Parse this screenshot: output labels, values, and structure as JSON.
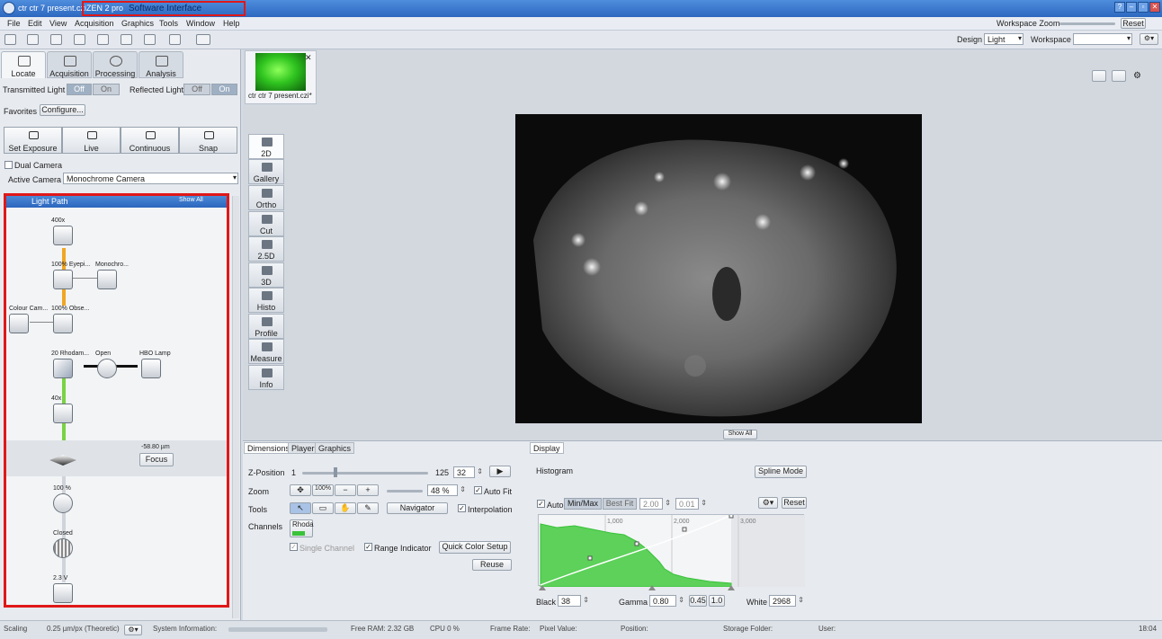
{
  "title_bar": {
    "document": "ctr ctr 7 present.czi",
    "app_name": "ZEN 2 pro",
    "annotation": "Software Interface",
    "buttons": [
      "?",
      "–",
      "▫",
      "✕"
    ]
  },
  "menu": [
    "File",
    "Edit",
    "View",
    "Acquisition",
    "Graphics",
    "Tools",
    "Window",
    "Help"
  ],
  "top_right": {
    "workspace_zoom_label": "Workspace Zoom",
    "reset_label": "Reset",
    "design_label": "Design",
    "design_value": "Light",
    "workspace_label": "Workspace",
    "workspace_value": ""
  },
  "left_tabs": [
    {
      "label": "Locate",
      "icon": "microscope-icon"
    },
    {
      "label": "Acquisition",
      "icon": "camera-icon"
    },
    {
      "label": "Processing",
      "icon": "gear-icon"
    },
    {
      "label": "Analysis",
      "icon": "chart-icon"
    }
  ],
  "light": {
    "transmitted_label": "Transmitted Light",
    "reflected_label": "Reflected Light",
    "off": "Off",
    "on": "On"
  },
  "favorites": {
    "label": "Favorites",
    "configure": "Configure..."
  },
  "camera_buttons": [
    "Set Exposure",
    "Live",
    "Continuous",
    "Snap"
  ],
  "dual_camera_label": "Dual Camera",
  "active_camera": {
    "label": "Active Camera",
    "value": "Monochrome Camera"
  },
  "light_path": {
    "header": "Light Path",
    "show_all": "Show All",
    "nodes": {
      "eyepiece_mag": "400x",
      "eyepiece": "100% Eyepi...",
      "mono_cam": "Monochro...",
      "colour_cam": "Colour Cam...",
      "observer": "100% Obse...",
      "filter": "20 Rhodam...",
      "shutter": "Open",
      "lamp": "HBO Lamp",
      "objective": "40x",
      "z_value": "-58.80 µm",
      "focus": "Focus",
      "intensity": "100 %",
      "aperture": "Closed",
      "voltage": "2.3 V"
    }
  },
  "document_tab": "ctr ctr 7 present.czi*",
  "view_tabs": [
    "2D",
    "Gallery",
    "Ortho",
    "Cut",
    "2.5D",
    "3D",
    "Histo",
    "Profile",
    "Measure",
    "Info"
  ],
  "show_all_center": "Show All",
  "bottom_left": {
    "tabs": [
      "Dimensions",
      "Player",
      "Graphics"
    ],
    "z_position": {
      "label": "Z-Position",
      "min": "1",
      "max": "125",
      "value": "32",
      "fraction": 0.25
    },
    "zoom": {
      "label": "Zoom",
      "preset": "100%",
      "value": "48 %",
      "auto_fit": "Auto Fit"
    },
    "tools": {
      "label": "Tools",
      "navigator": "Navigator",
      "interpolation": "Interpolation"
    },
    "channels": {
      "label": "Channels",
      "channel": "Rhoda",
      "single": "Single Channel",
      "range": "Range Indicator",
      "quick_color": "Quick Color Setup",
      "reuse": "Reuse"
    }
  },
  "display": {
    "tab": "Display",
    "histogram_label": "Histogram",
    "spline_mode": "Spline Mode",
    "auto": "Auto",
    "min_max": "Min/Max",
    "best_fit": "Best Fit",
    "v1": "2.00",
    "v2": "0.01",
    "reset": "Reset",
    "tick_1000": "1,000",
    "tick_2000": "2,000",
    "tick_3000": "3,000",
    "black_label": "Black",
    "black_value": "38",
    "gamma_label": "Gamma",
    "gamma_value": "0.80",
    "gamma_b1": "0.45",
    "gamma_b2": "1.0",
    "white_label": "White",
    "white_value": "2968"
  },
  "status": {
    "scaling_label": "Scaling",
    "scaling_value": "0.25 µm/px (Theoretic)",
    "sysinfo": "System Information:",
    "free_ram": "Free RAM: 2.32 GB",
    "cpu": "CPU 0 %",
    "frame_rate": "Frame Rate:",
    "pixel_value": "Pixel Value:",
    "position": "Position:",
    "storage": "Storage Folder:",
    "user": "User:",
    "time": "18:04"
  },
  "colors": {
    "title_blue": "#2c68c0",
    "highlight_red": "#e01818",
    "histogram_green": "#39c23a"
  }
}
